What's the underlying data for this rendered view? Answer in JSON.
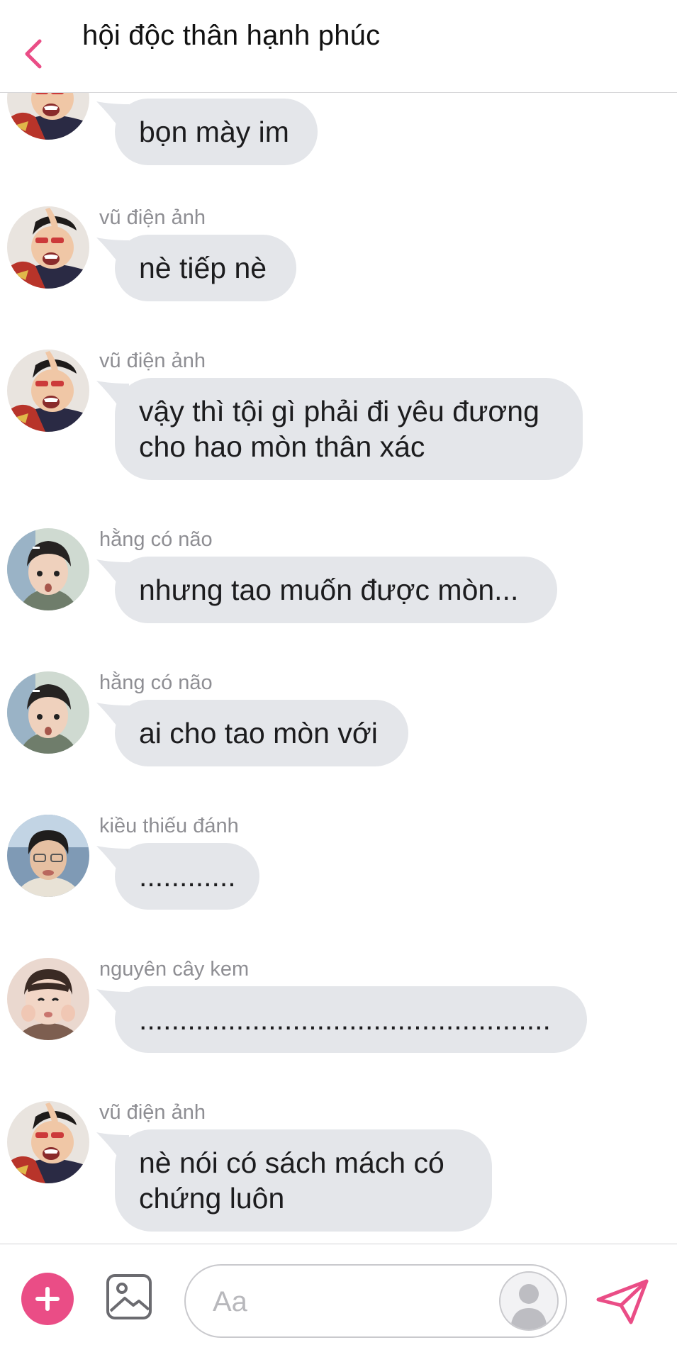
{
  "header": {
    "title": "hội độc thân hạnh phúc",
    "back_icon": "chevron-left-icon",
    "accent": "#ea4d86"
  },
  "messages": [
    {
      "sender": "",
      "text": "bọn mày im",
      "avatar": "avatar-vu"
    },
    {
      "sender": "vũ điện ảnh",
      "text": "nè tiếp nè",
      "avatar": "avatar-vu"
    },
    {
      "sender": "vũ điện ảnh",
      "text": "vậy thì tội gì phải đi yêu đương cho hao mòn thân xác",
      "avatar": "avatar-vu"
    },
    {
      "sender": "hằng có não",
      "text": "nhưng tao muốn được mòn...",
      "avatar": "avatar-hang"
    },
    {
      "sender": "hằng có não",
      "text": "ai cho tao mòn với",
      "avatar": "avatar-hang"
    },
    {
      "sender": "kiều thiếu đánh",
      "text": "............",
      "avatar": "avatar-kieu"
    },
    {
      "sender": "nguyên cây kem",
      "text": "...................................................",
      "avatar": "avatar-nguyen"
    },
    {
      "sender": "vũ điện ảnh",
      "text": "nè nói có sách mách có chứng luôn",
      "avatar": "avatar-vu"
    }
  ],
  "footer": {
    "input_placeholder": "Aa",
    "plus_icon": "plus-icon",
    "image_icon": "image-icon",
    "sticker_icon": "sticker-avatar-icon",
    "send_icon": "send-icon"
  },
  "colors": {
    "bubble_bg": "#e4e6ea",
    "sender_text": "#8e8e93",
    "accent": "#ea4d86"
  }
}
